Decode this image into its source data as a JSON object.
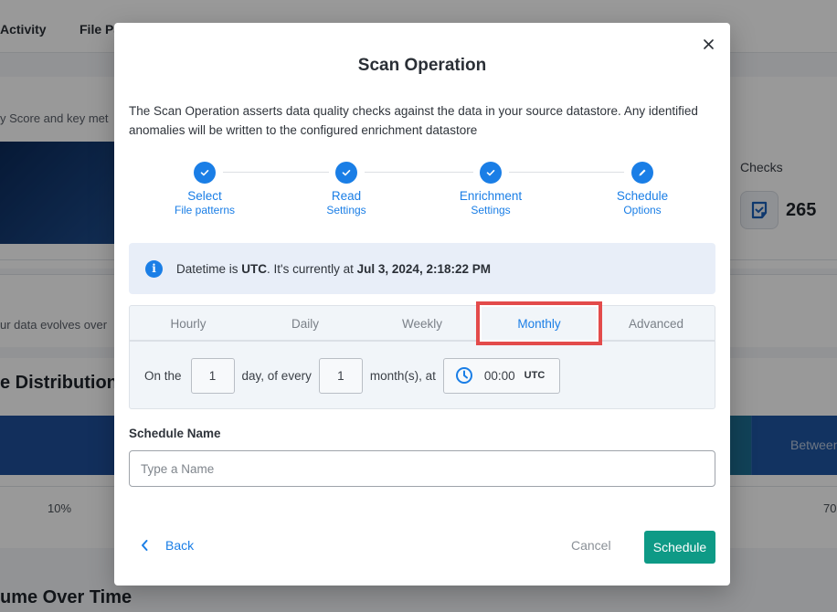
{
  "background": {
    "nav_tabs": [
      "Activity",
      "File Pa"
    ],
    "subtext": "y Score and key met",
    "checks_label": "Checks",
    "checks_count": "265",
    "evolve_text": "ur data evolves over",
    "distribution_title": "e Distribution",
    "distribution_between": "Between",
    "pct_left": "10%",
    "pct_right": "70",
    "volume_title": "ume Over Time"
  },
  "modal": {
    "title": "Scan Operation",
    "description": "The Scan Operation asserts data quality checks against the data in your source datastore. Any identified anomalies will be written to the configured enrichment datastore",
    "steps": [
      {
        "title": "Select",
        "subtitle": "File patterns",
        "state": "complete"
      },
      {
        "title": "Read",
        "subtitle": "Settings",
        "state": "complete"
      },
      {
        "title": "Enrichment",
        "subtitle": "Settings",
        "state": "complete"
      },
      {
        "title": "Schedule",
        "subtitle": "Options",
        "state": "current"
      }
    ],
    "info": {
      "prefix": "Datetime is ",
      "tz": "UTC",
      "middle": ". It's currently at ",
      "datetime": "Jul 3, 2024, 2:18:22 PM"
    },
    "schedule_tabs": [
      "Hourly",
      "Daily",
      "Weekly",
      "Monthly",
      "Advanced"
    ],
    "active_tab": "Monthly",
    "monthly": {
      "on_the_label": "On the",
      "day_value": "1",
      "day_of_every_label": "day, of every",
      "month_value": "1",
      "months_at_label": "month(s), at",
      "time_value": "00:00",
      "time_zone": "UTC"
    },
    "schedule_name_label": "Schedule Name",
    "schedule_name_value": "",
    "schedule_name_placeholder": "Type a Name",
    "back_label": "Back",
    "cancel_label": "Cancel",
    "schedule_label": "Schedule"
  },
  "colors": {
    "accent": "#1a7ee6",
    "primary_button": "#0e9a86",
    "highlight": "#e34b4b"
  }
}
